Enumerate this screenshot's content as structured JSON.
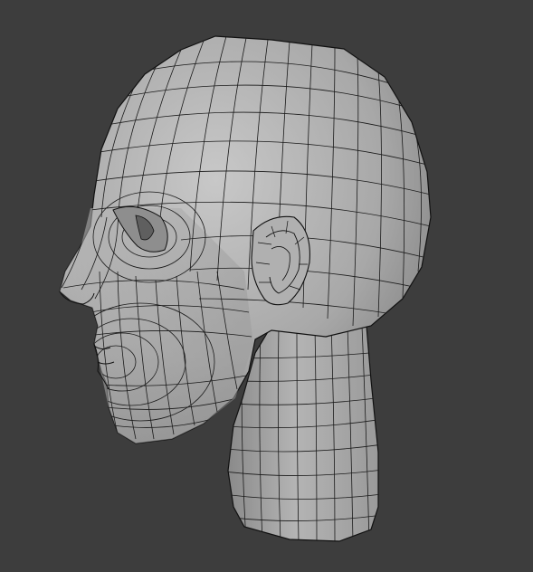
{
  "scene": {
    "background_color": "#3d3d3d",
    "mesh_fill_color": "#a9a9a9",
    "wire_color": "#141414",
    "object": "human-head-wireframe"
  }
}
